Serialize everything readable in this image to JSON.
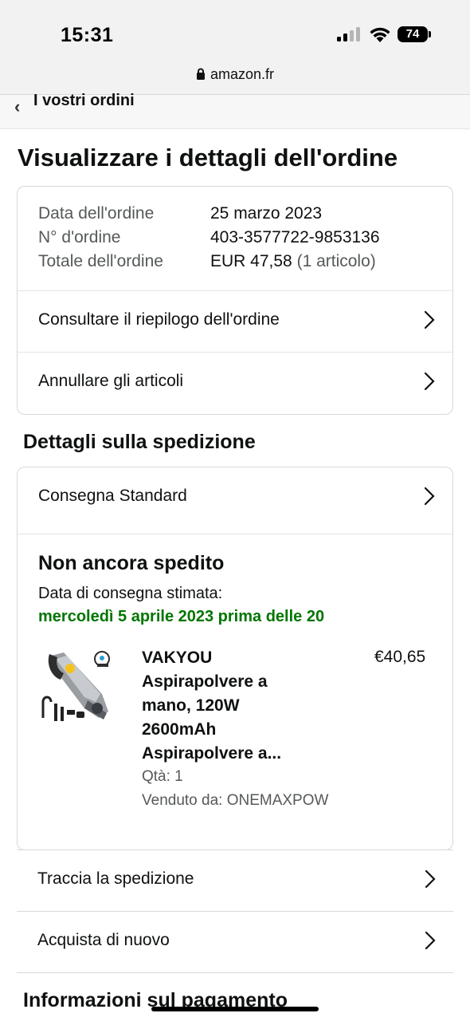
{
  "status_bar": {
    "time": "15:31",
    "battery": "74"
  },
  "browser": {
    "url": "amazon.fr"
  },
  "nav": {
    "back_label": "I vostri ordini"
  },
  "page": {
    "title": "Visualizzare i dettagli dell'ordine"
  },
  "order": {
    "date_label": "Data dell'ordine",
    "date_value": "25 marzo 2023",
    "number_label": "N° d'ordine",
    "number_value": "403-3577722-9853136",
    "total_label": "Totale dell'ordine",
    "total_value": "EUR 47,58",
    "total_items": "(1 articolo)",
    "summary_link": "Consultare il riepilogo dell'ordine",
    "cancel_link": "Annullare gli articoli"
  },
  "shipment": {
    "section_title": "Dettagli sulla spedizione",
    "method": "Consegna Standard",
    "status": "Non ancora spedito",
    "estimate_label": "Data di consegna stimata:",
    "estimate_date": "mercoledì 5 aprile 2023 prima delle 20",
    "item": {
      "title_line1": "VAKYOU",
      "title_line2": "Aspirapolvere a",
      "title_line3": "mano, 120W",
      "title_line4": "2600mAh",
      "title_line5": "Aspirapolvere a...",
      "price": "€40,65",
      "qty": "Qtà: 1",
      "seller": "Venduto da: ONEMAXPOW"
    },
    "track_link": "Traccia la spedizione",
    "buy_again_link": "Acquista di nuovo"
  },
  "payment": {
    "section_title": "Informazioni sul pagamento"
  },
  "colors": {
    "delivery_green": "#007600",
    "border": "#d5d9d9"
  }
}
